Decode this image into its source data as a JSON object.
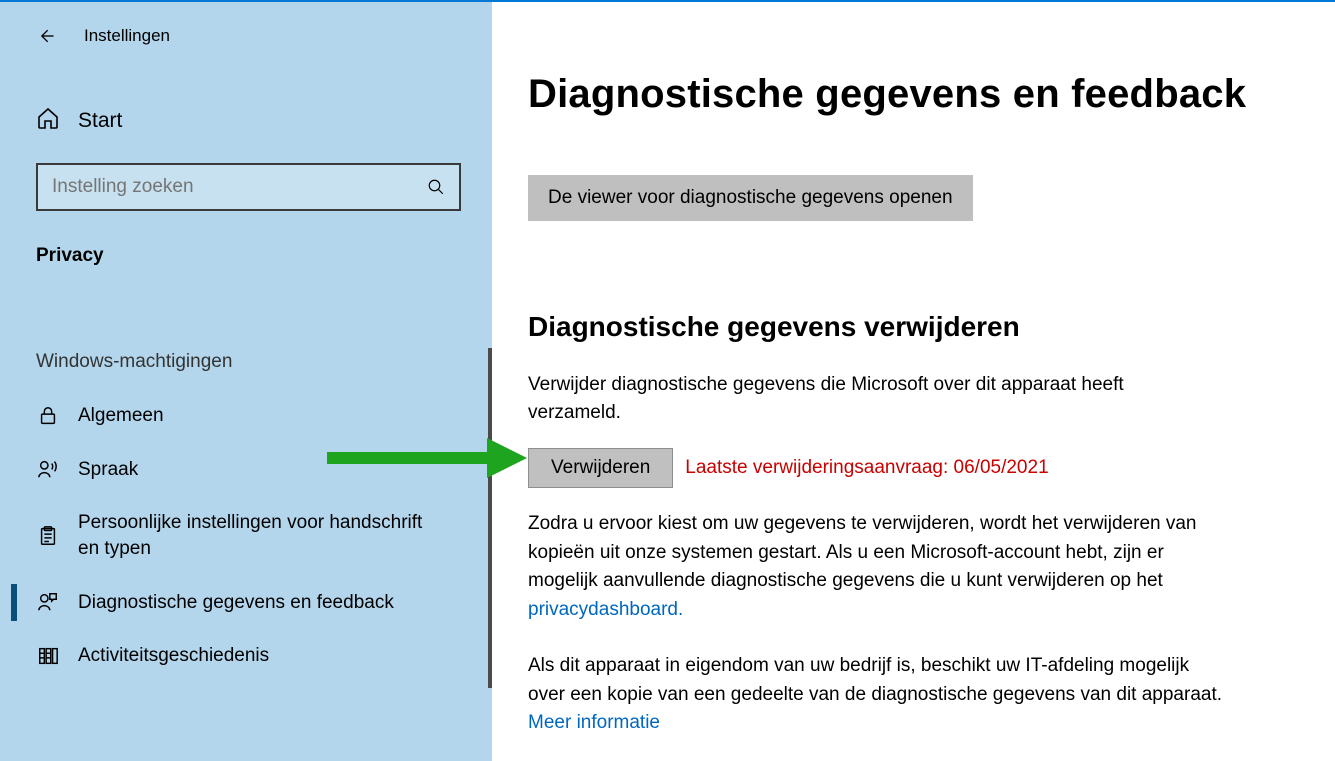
{
  "header": {
    "app_title": "Instellingen"
  },
  "sidebar": {
    "start_label": "Start",
    "search_placeholder": "Instelling zoeken",
    "section": "Privacy",
    "group_label": "Windows-machtigingen",
    "items": [
      {
        "label": "Algemeen"
      },
      {
        "label": "Spraak"
      },
      {
        "label": "Persoonlijke instellingen voor handschrift en typen"
      },
      {
        "label": "Diagnostische gegevens en feedback"
      },
      {
        "label": "Activiteitsgeschiedenis"
      }
    ]
  },
  "content": {
    "page_title": "Diagnostische gegevens en feedback",
    "open_viewer_label": "De viewer voor diagnostische gegevens openen",
    "delete_section_heading": "Diagnostische gegevens verwijderen",
    "delete_intro": "Verwijder diagnostische gegevens die Microsoft over dit apparaat heeft verzameld.",
    "delete_button_label": "Verwijderen",
    "last_delete_request": "Laatste verwijderingsaanvraag: 06/05/2021",
    "body1_before_link": "Zodra u ervoor kiest om uw gegevens te verwijderen, wordt het verwijderen van kopieën uit onze systemen gestart. Als u een Microsoft-account hebt, zijn er mogelijk aanvullende diagnostische gegevens die u kunt verwijderen op het ",
    "body1_link": "privacydashboard.",
    "body2_before_link": "Als dit apparaat in eigendom van uw bedrijf is, beschikt uw IT-afdeling mogelijk over een kopie van een gedeelte van de diagnostische gegevens van dit apparaat. ",
    "body2_link": "Meer informatie"
  }
}
